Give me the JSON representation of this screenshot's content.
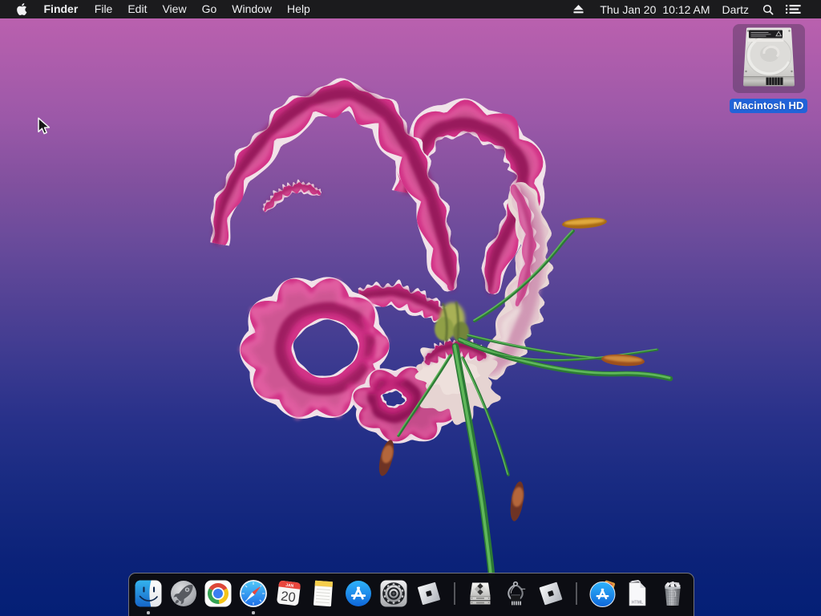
{
  "menu_bar": {
    "app_menu": "Finder",
    "menus": [
      {
        "label": "File"
      },
      {
        "label": "Edit"
      },
      {
        "label": "View"
      },
      {
        "label": "Go"
      },
      {
        "label": "Window"
      },
      {
        "label": "Help"
      }
    ],
    "status": {
      "date": "Thu Jan 20",
      "time": "10:12 AM",
      "user": "Dartz"
    },
    "icons": [
      "eject-icon",
      "search-icon",
      "list-icon"
    ]
  },
  "desktop": {
    "selected_icon": {
      "label": "Macintosh HD",
      "selected": true
    },
    "wallpaper": {
      "top": "#cb66b2",
      "middle": "#7252a9",
      "bottom": "#1b2f94"
    }
  },
  "dock": {
    "items": [
      {
        "id": "finder",
        "label": "Finder",
        "running": true
      },
      {
        "id": "launchpad",
        "label": "Launchpad",
        "running": false
      },
      {
        "id": "chrome",
        "label": "Google Chrome",
        "running": false
      },
      {
        "id": "safari",
        "label": "Safari",
        "running": true
      },
      {
        "id": "calendar",
        "label": "Calendar",
        "running": false
      },
      {
        "id": "notes",
        "label": "Notes",
        "running": false
      },
      {
        "id": "app-store",
        "label": "App Store",
        "running": false
      },
      {
        "id": "system-preferences",
        "label": "System Preferences",
        "running": false
      },
      {
        "id": "roblox",
        "label": "Roblox",
        "running": false
      },
      {
        "id": "disk-drive",
        "label": "Disk Drive",
        "running": false
      },
      {
        "id": "chip-tool",
        "label": "Chip Tool",
        "running": false
      },
      {
        "id": "roblox-studio",
        "label": "Roblox Studio",
        "running": false
      },
      {
        "id": "applications",
        "label": "Applications",
        "running": false
      },
      {
        "id": "html-file",
        "label": "HTML File",
        "running": false
      },
      {
        "id": "trash",
        "label": "Trash",
        "running": false
      }
    ],
    "calendar": {
      "month": "JAN",
      "day": "20"
    },
    "html_label": "HTML"
  }
}
